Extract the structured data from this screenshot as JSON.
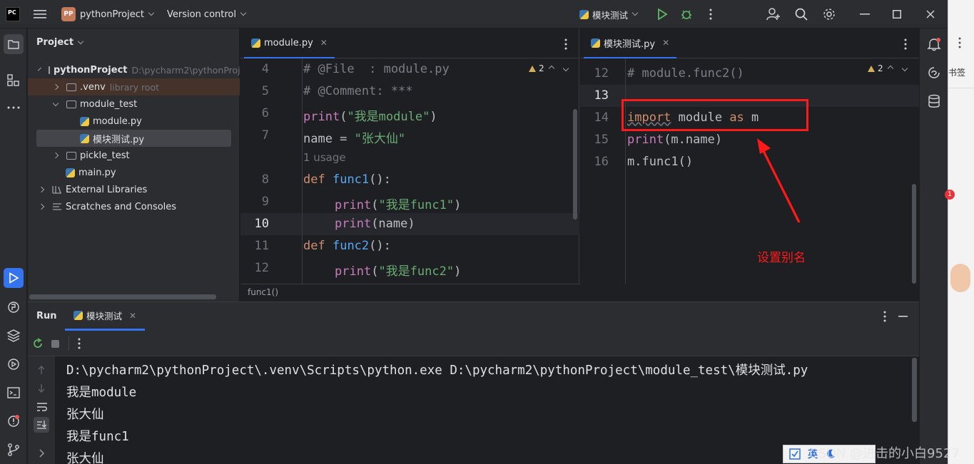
{
  "titlebar": {
    "logo": "PC",
    "project_badge": "PP",
    "project_name": "pythonProject",
    "version_control": "Version control",
    "run_config": "模块测试"
  },
  "project_panel": {
    "title": "Project",
    "items": [
      {
        "label": "pythonProject",
        "hint": "D:\\pycharm2\\pythonProj"
      },
      {
        "label": ".venv",
        "hint": "library root"
      },
      {
        "label": "module_test",
        "hint": ""
      },
      {
        "label": "module.py",
        "hint": ""
      },
      {
        "label": "模块测试.py",
        "hint": ""
      },
      {
        "label": "pickle_test",
        "hint": ""
      },
      {
        "label": "main.py",
        "hint": ""
      },
      {
        "label": "External Libraries",
        "hint": ""
      },
      {
        "label": "Scratches and Consoles",
        "hint": ""
      }
    ]
  },
  "editor_left": {
    "tab": "module.py",
    "warnings": "2",
    "breadcrumb": "func1()",
    "line_numbers": [
      "4",
      "5",
      "6",
      "7",
      "8",
      "9",
      "10",
      "11",
      "12"
    ],
    "usage_hint": "1 usage",
    "lines": {
      "l4": "# @File  : module.py",
      "l5": "# @Comment: ***",
      "l6_fn": "print",
      "l6_open": "(",
      "l6_str": "\"我是module\"",
      "l6_close": ")",
      "l7_a": "name = ",
      "l7_str": "\"张大仙\"",
      "l8_kw": "def",
      "l8_fn": "func1",
      "l8_rest": "():",
      "l9_fn": "print",
      "l9_open": "(",
      "l9_str": "\"我是func1\"",
      "l9_close": ")",
      "l10_fn": "print",
      "l10_rest": "(name)",
      "l11_kw": "def",
      "l11_fn": "func2",
      "l11_rest": "():",
      "l12_fn": "print",
      "l12_open": "(",
      "l12_str": "\"我是func2\"",
      "l12_close": ")"
    }
  },
  "editor_right": {
    "tab": "模块测试.py",
    "warnings": "2",
    "line_numbers": [
      "12",
      "13",
      "14",
      "15",
      "16"
    ],
    "lines": {
      "l12": "# module.func2()",
      "l14_kw1": "import",
      "l14_a": " module ",
      "l14_kw2": "as",
      "l14_b": " m",
      "l15_fn": "print",
      "l15_rest": "(m.name)",
      "l16": "m.func1()"
    },
    "annotation": "设置别名"
  },
  "run_panel": {
    "title": "Run",
    "tab": "模块测试",
    "output": [
      "D:\\pycharm2\\pythonProject\\.venv\\Scripts\\python.exe D:\\pycharm2\\pythonProject\\module_test\\模块测试.py",
      "我是module",
      "张大仙",
      "我是func1",
      "张大仙"
    ]
  },
  "browser_side": {
    "bookmark": "书签",
    "badge": "1"
  },
  "watermark": "CSDN @进击的小白9527",
  "ime_label": "英",
  "colors": {
    "accent": "#3574f0",
    "annotation_red": "#ff1a1a",
    "run_green": "#5fb865"
  }
}
